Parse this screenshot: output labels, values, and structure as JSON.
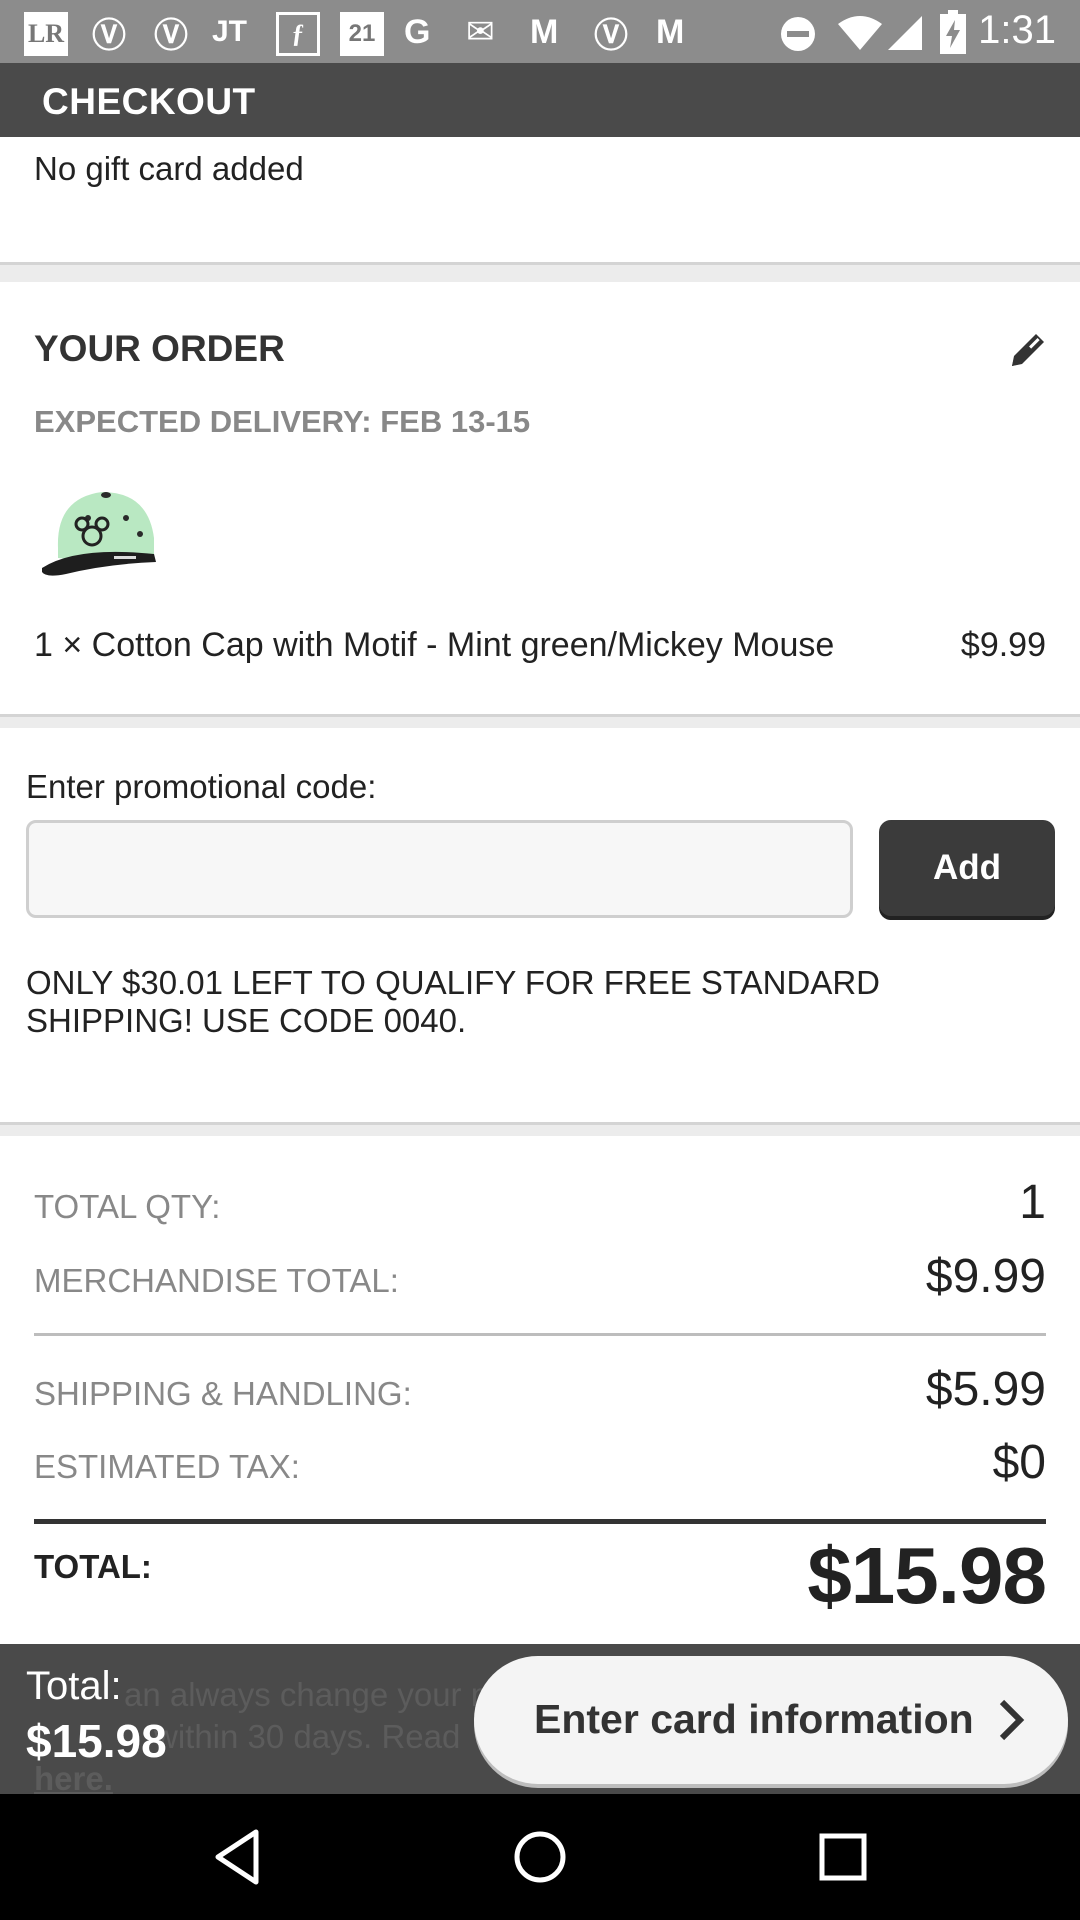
{
  "status_bar": {
    "time": "1:31",
    "left_icons": [
      "LR",
      "Ⓥ",
      "Ⓥ",
      "JT",
      "ƒ",
      "21",
      "G",
      "✉",
      "M",
      "Ⓥ",
      "M"
    ],
    "right_icons": [
      "do-not-disturb-icon",
      "wifi-icon",
      "signal-icon",
      "battery-charging-icon"
    ]
  },
  "header": {
    "title": "CHECKOUT"
  },
  "gift_card": {
    "text": "No gift card added"
  },
  "order": {
    "title": "YOUR ORDER",
    "delivery": "EXPECTED DELIVERY: FEB 13-15",
    "items": [
      {
        "description": "1 × Cotton Cap with Motif - Mint green/Mickey Mouse",
        "price": "$9.99"
      }
    ]
  },
  "promo": {
    "label": "Enter promotional code:",
    "input_value": "",
    "add_label": "Add",
    "note": "ONLY $30.01 LEFT TO QUALIFY FOR FREE STANDARD SHIPPING! USE CODE 0040."
  },
  "summary": {
    "rows": [
      {
        "label": "TOTAL QTY:",
        "value": "1"
      },
      {
        "label": "MERCHANDISE TOTAL:",
        "value": "$9.99"
      },
      {
        "label": "SHIPPING & HANDLING:",
        "value": "$5.99"
      },
      {
        "label": "ESTIMATED TAX:",
        "value": "$0"
      }
    ],
    "total_label": "TOTAL:",
    "total_value": "$15.98",
    "obscured_note_visible": "an always change your m",
    "obscured_note_line2": "within 30 days. Read",
    "obscured_link": "here."
  },
  "bottom_bar": {
    "total_label": "Total:",
    "total_value": "$15.98",
    "button_label": "Enter card information"
  },
  "colors": {
    "status_bar": "#8c8c8c",
    "app_bar": "#4a4a4a",
    "add_button": "#3b3b3b",
    "card_button": "#f4f4f4"
  }
}
